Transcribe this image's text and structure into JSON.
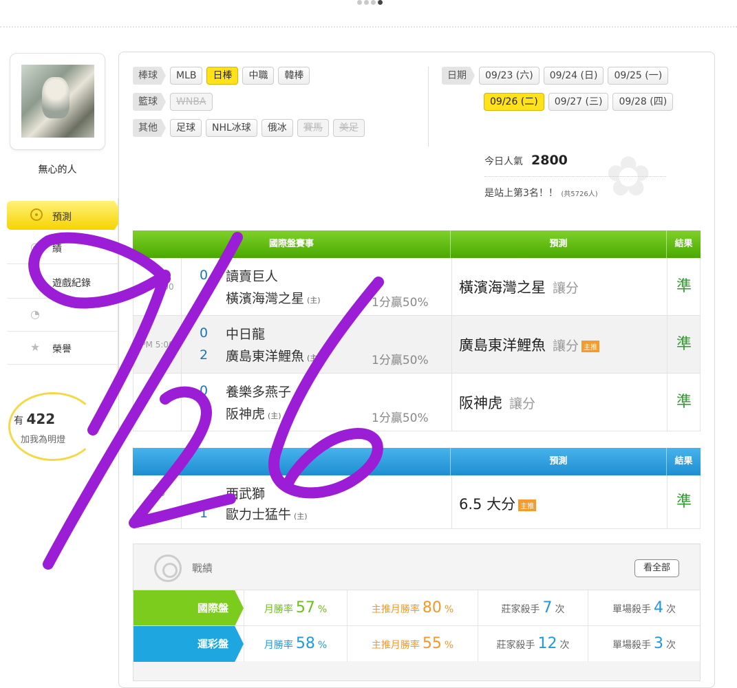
{
  "user": {
    "name": "無心的人"
  },
  "sidebar": {
    "items": [
      {
        "label": "預測",
        "active": true
      },
      {
        "label": "績"
      },
      {
        "label": "遊戲紀錄"
      },
      {
        "label": ""
      },
      {
        "label": "榮譽"
      }
    ],
    "fans_prefix": "有",
    "fans_count": "422",
    "fans_link": "加我為明燈"
  },
  "filters": {
    "baseball": {
      "label": "棒球",
      "tags": [
        "MLB",
        "日棒",
        "中職",
        "韓棒"
      ],
      "selected": "日棒"
    },
    "basketball": {
      "label": "籃球",
      "tags": [
        "WNBA"
      ]
    },
    "other": {
      "label": "其他",
      "tags": [
        "足球",
        "NHL冰球",
        "俄冰",
        "賽馬",
        "美足"
      ]
    }
  },
  "dates": {
    "label": "日期",
    "items": [
      "09/23 (六)",
      "09/24 (日)",
      "09/25 (一)",
      "09/26 (二)",
      "09/27 (三)",
      "09/28 (四)"
    ],
    "selected": "09/26 (二)"
  },
  "popularity": {
    "label": "今日人氣",
    "value": "2800",
    "rank_text": "是站上第3名！！",
    "rank_total": "(共5726人)"
  },
  "intl_table": {
    "headers": {
      "game": "國際盤賽事",
      "pred": "預測",
      "result": "結果"
    },
    "rows": [
      {
        "time": "PM 5:00",
        "away_score": "0",
        "away": "讀賣巨人",
        "home_score": "1",
        "home": "橫濱海灣之星",
        "home_tag": "(主)",
        "line": "1分贏50%",
        "pick": "橫濱海灣之星",
        "pick_type": "讓分",
        "main": false,
        "result": "準"
      },
      {
        "time": "PM 5:00",
        "away_score": "0",
        "away": "中日龍",
        "home_score": "2",
        "home": "廣島東洋鯉魚",
        "home_tag": "(主)",
        "line": "1分贏50%",
        "pick": "廣島東洋鯉魚",
        "pick_type": "讓分",
        "main": true,
        "main_label": "主推",
        "result": "準"
      },
      {
        "time": "",
        "away_score": "0",
        "away": "養樂多燕子",
        "home_score": "2",
        "home": "阪神虎",
        "home_tag": "(主)",
        "line": "1分贏50%",
        "pick": "阪神虎",
        "pick_type": "讓分",
        "main": false,
        "result": "準"
      }
    ]
  },
  "lottery_table": {
    "headers": {
      "pred": "預測",
      "result": "結果"
    },
    "rows": [
      {
        "time": "105",
        "away_score": "",
        "away": "西武獅",
        "home_score": "1",
        "home": "歐力士猛牛",
        "home_tag": "(主)",
        "pick": "6.5 大分",
        "main": true,
        "main_label": "主推",
        "result": "準"
      }
    ]
  },
  "record": {
    "title": "戰績",
    "view_all": "看全部",
    "rows": [
      {
        "label": "國際盤",
        "monthly_label": "月勝率",
        "monthly": "57",
        "main_label": "主推月勝率",
        "main": "80",
        "banker_label": "莊家殺手",
        "banker": "7",
        "single_label": "單場殺手",
        "single": "4",
        "pct": "%",
        "times": "次"
      },
      {
        "label": "運彩盤",
        "monthly_label": "月勝率",
        "monthly": "58",
        "main_label": "主推月勝率",
        "main": "55",
        "banker_label": "莊家殺手",
        "banker": "12",
        "single_label": "單場殺手",
        "single": "3",
        "pct": "%",
        "times": "次"
      }
    ]
  },
  "colors": {
    "scribble": "#9b1dd6",
    "green": "#6dbf1a",
    "blue": "#1d9ad9",
    "yellow": "#ffe21a"
  }
}
